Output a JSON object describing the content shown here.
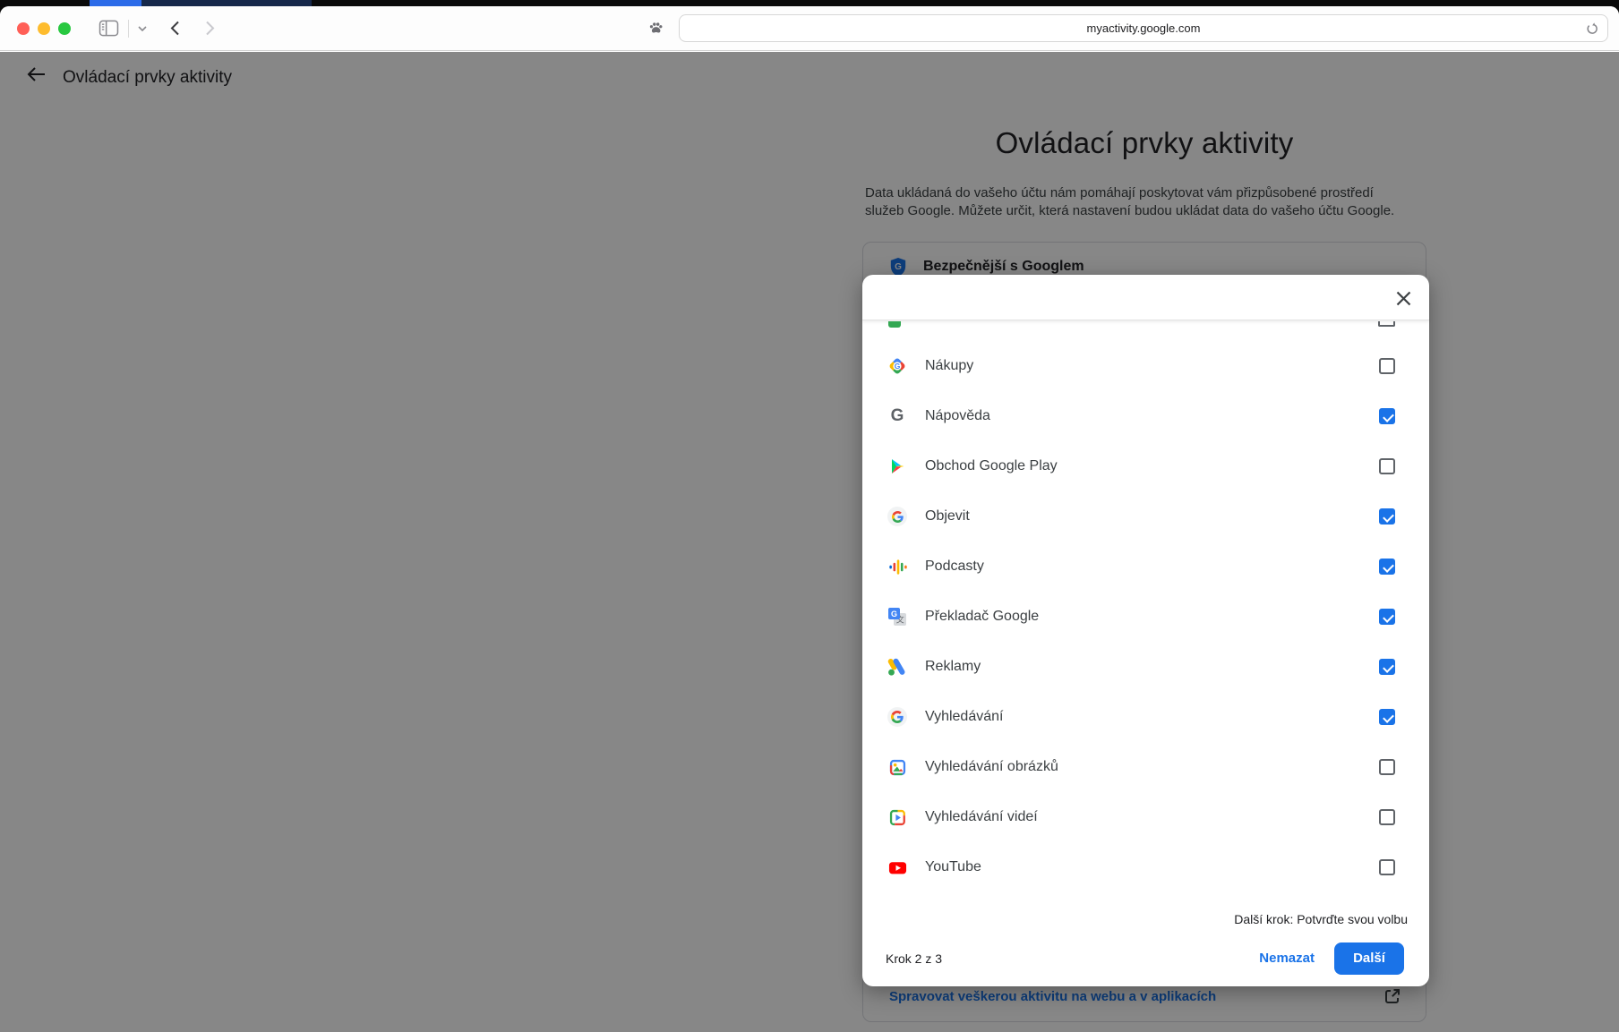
{
  "browser": {
    "url": "myactivity.google.com",
    "icons": [
      "sidebar-icon",
      "tab-chevron-icon",
      "back-icon",
      "forward-icon",
      "paw-extension-icon",
      "reload-icon"
    ]
  },
  "page": {
    "header_title": "Ovládací prvky aktivity",
    "main_title": "Ovládací prvky aktivity",
    "description": "Data ukládaná do vašeho účtu nám pomáhají poskytovat vám přizpůsobené prostředí služeb Google. Můžete určit, která nastavení budou ukládat data do vašeho účtu Google.",
    "card": {
      "title": "Bezpečnější s Googlem",
      "footer_link": "Spravovat veškerou aktivitu na webu a v aplikacích"
    }
  },
  "modal": {
    "partial_top_row": {
      "icon": "cut-off-service-icon",
      "checked": false
    },
    "items": [
      {
        "label": "Nákupy",
        "icon": "google-shopping-icon",
        "checked": false
      },
      {
        "label": "Nápověda",
        "icon": "google-help-icon",
        "checked": true
      },
      {
        "label": "Obchod Google Play",
        "icon": "google-play-icon",
        "checked": false
      },
      {
        "label": "Objevit",
        "icon": "google-discover-icon",
        "checked": true
      },
      {
        "label": "Podcasty",
        "icon": "google-podcasts-icon",
        "checked": true
      },
      {
        "label": "Překladač Google",
        "icon": "google-translate-icon",
        "checked": true
      },
      {
        "label": "Reklamy",
        "icon": "google-ads-icon",
        "checked": true
      },
      {
        "label": "Vyhledávání",
        "icon": "google-search-icon",
        "checked": true
      },
      {
        "label": "Vyhledávání obrázků",
        "icon": "image-search-icon",
        "checked": false
      },
      {
        "label": "Vyhledávání videí",
        "icon": "video-search-icon",
        "checked": false
      },
      {
        "label": "YouTube",
        "icon": "youtube-icon",
        "checked": false
      }
    ],
    "next_step_hint": "Další krok: Potvrďte svou volbu",
    "step_indicator": "Krok 2 z 3",
    "secondary_button": "Nemazat",
    "primary_button": "Další"
  },
  "colors": {
    "accent": "#1a73e8",
    "checkbox_border": "#5f6368",
    "overlay": "rgba(0,0,0,0.47)",
    "youtube_red": "#ff0000"
  }
}
